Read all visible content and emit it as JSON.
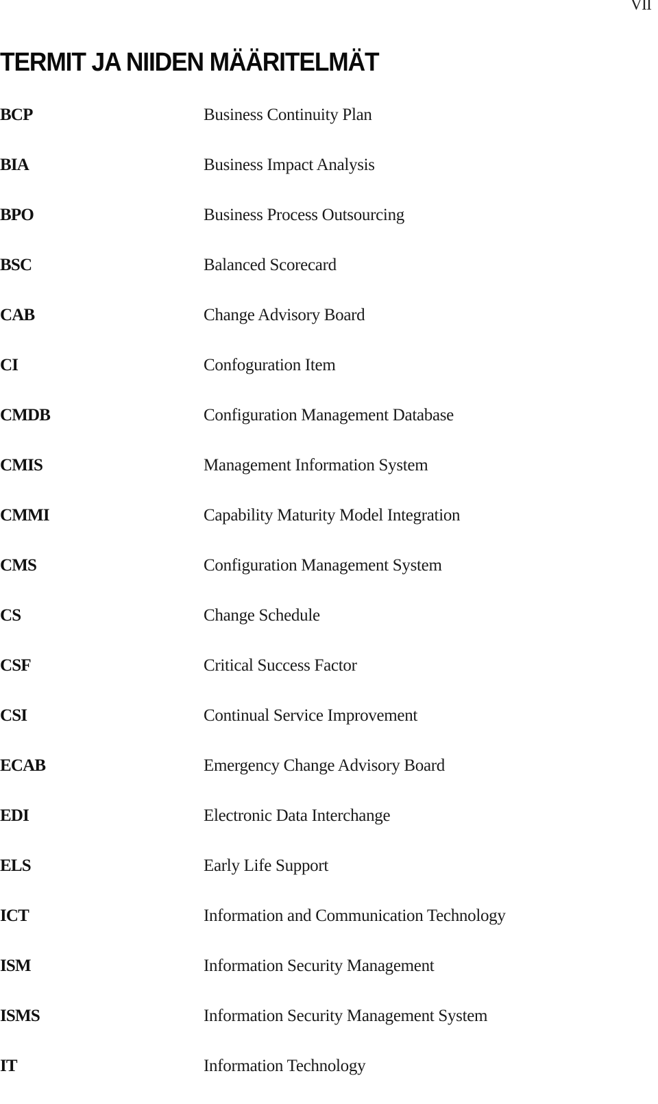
{
  "page": {
    "number": "VII",
    "title": "TERMIT JA NIIDEN MÄÄRITELMÄT"
  },
  "terms": [
    {
      "abbr": "BCP",
      "definition": "Business Continuity Plan"
    },
    {
      "abbr": "BIA",
      "definition": "Business Impact Analysis"
    },
    {
      "abbr": "BPO",
      "definition": "Business Process Outsourcing"
    },
    {
      "abbr": "BSC",
      "definition": "Balanced Scorecard"
    },
    {
      "abbr": "CAB",
      "definition": "Change Advisory Board"
    },
    {
      "abbr": "CI",
      "definition": "Confoguration Item"
    },
    {
      "abbr": "CMDB",
      "definition": "Configuration Management Database"
    },
    {
      "abbr": "CMIS",
      "definition": "Management Information System"
    },
    {
      "abbr": "CMMI",
      "definition": "Capability Maturity Model Integration"
    },
    {
      "abbr": "CMS",
      "definition": "Configuration Management System"
    },
    {
      "abbr": "CS",
      "definition": "Change Schedule"
    },
    {
      "abbr": "CSF",
      "definition": "Critical Success Factor"
    },
    {
      "abbr": "CSI",
      "definition": "Continual Service Improvement"
    },
    {
      "abbr": "ECAB",
      "definition": "Emergency Change Advisory Board"
    },
    {
      "abbr": "EDI",
      "definition": "Electronic Data Interchange"
    },
    {
      "abbr": "ELS",
      "definition": "Early Life Support"
    },
    {
      "abbr": "ICT",
      "definition": "Information and Communication Technology"
    },
    {
      "abbr": "ISM",
      "definition": "Information Security Management"
    },
    {
      "abbr": "ISMS",
      "definition": "Information Security Management System"
    },
    {
      "abbr": "IT",
      "definition": "Information Technology"
    }
  ]
}
